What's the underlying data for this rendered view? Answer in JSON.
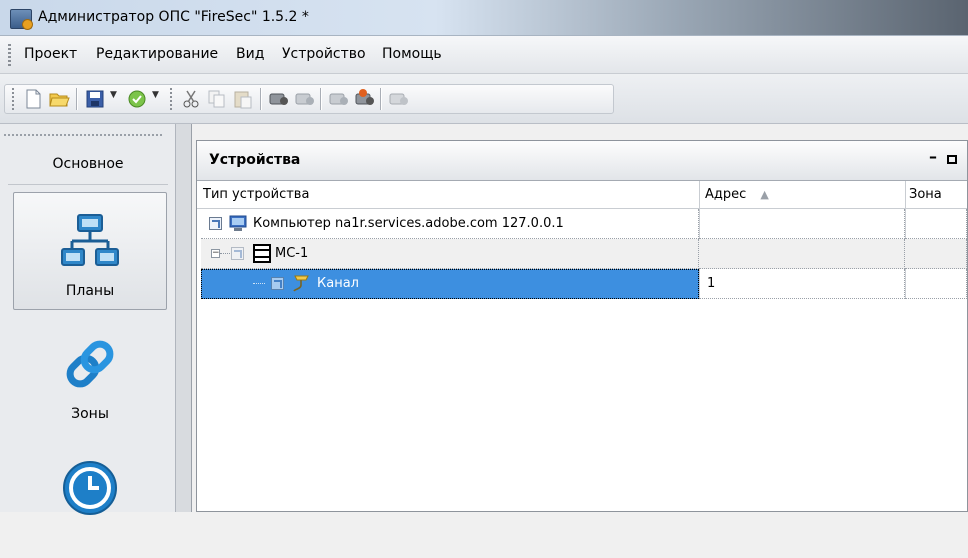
{
  "window": {
    "title": "Администратор ОПС \"FireSec\" 1.5.2 *"
  },
  "menu": {
    "items": [
      "Проект",
      "Редактирование",
      "Вид",
      "Устройство",
      "Помощь"
    ]
  },
  "toolbar": {
    "icons": [
      "new-file-icon",
      "open-folder-icon",
      "save-icon",
      "check-icon",
      "cut-icon",
      "copy-icon",
      "paste-icon",
      "device-read-icon",
      "device-write-icon",
      "device-sync-icon",
      "device-config-icon",
      "device-disabled-icon"
    ]
  },
  "nav": {
    "header": "Основное",
    "items": [
      {
        "label": "Планы",
        "icon": "network-plan-icon",
        "selected": true
      },
      {
        "label": "Зоны",
        "icon": "chain-link-icon",
        "selected": false
      },
      {
        "label": "",
        "icon": "clock-icon",
        "selected": false
      }
    ]
  },
  "panel": {
    "title": "Устройства",
    "columns": [
      "Тип устройства",
      "Адрес",
      "Зона"
    ],
    "sort_indicator": "▲",
    "rows": [
      {
        "name": "Компьютер na1r.services.adobe.com 127.0.0.1",
        "address": "",
        "zone": "",
        "level": 0,
        "icon": "computer-icon",
        "selected": false
      },
      {
        "name": "МС-1",
        "address": "",
        "zone": "",
        "level": 1,
        "icon": "module-icon",
        "expanded": true,
        "selected": false
      },
      {
        "name": "Канал",
        "address": "1",
        "zone": "",
        "level": 2,
        "icon": "channel-icon",
        "selected": true
      }
    ]
  },
  "colors": {
    "selection": "#3d8fe0",
    "panel_border": "#8e949c"
  }
}
